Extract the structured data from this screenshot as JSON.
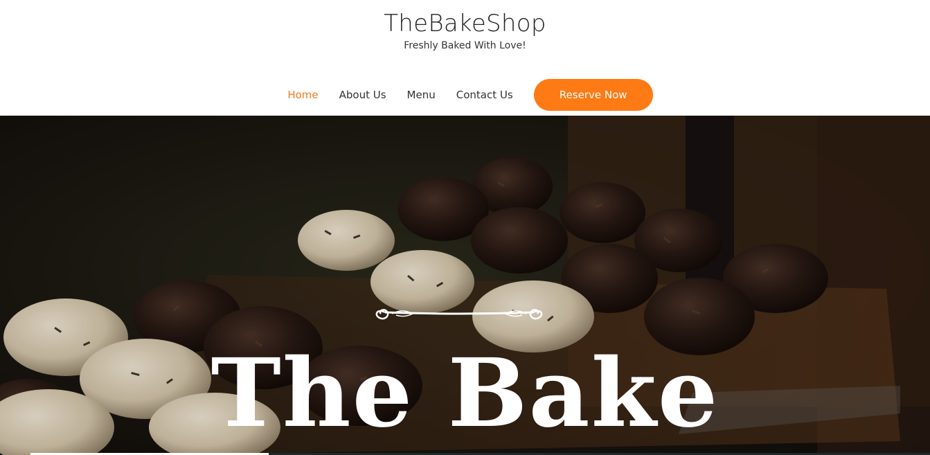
{
  "brand": {
    "title": "TheBakeShop",
    "tagline": "Freshly Baked With Love!"
  },
  "nav": {
    "items": [
      {
        "label": "Home",
        "active": true
      },
      {
        "label": "About Us",
        "active": false
      },
      {
        "label": "Menu",
        "active": false
      },
      {
        "label": "Contact Us",
        "active": false
      }
    ],
    "cta_label": "Reserve Now"
  },
  "hero": {
    "title": "The Bake",
    "ornament_icon": "scroll-flourish-icon",
    "image": "cupcakes-photo"
  },
  "colors": {
    "accent": "#fd7a14",
    "active_link": "#f47b20",
    "text": "#333333"
  }
}
